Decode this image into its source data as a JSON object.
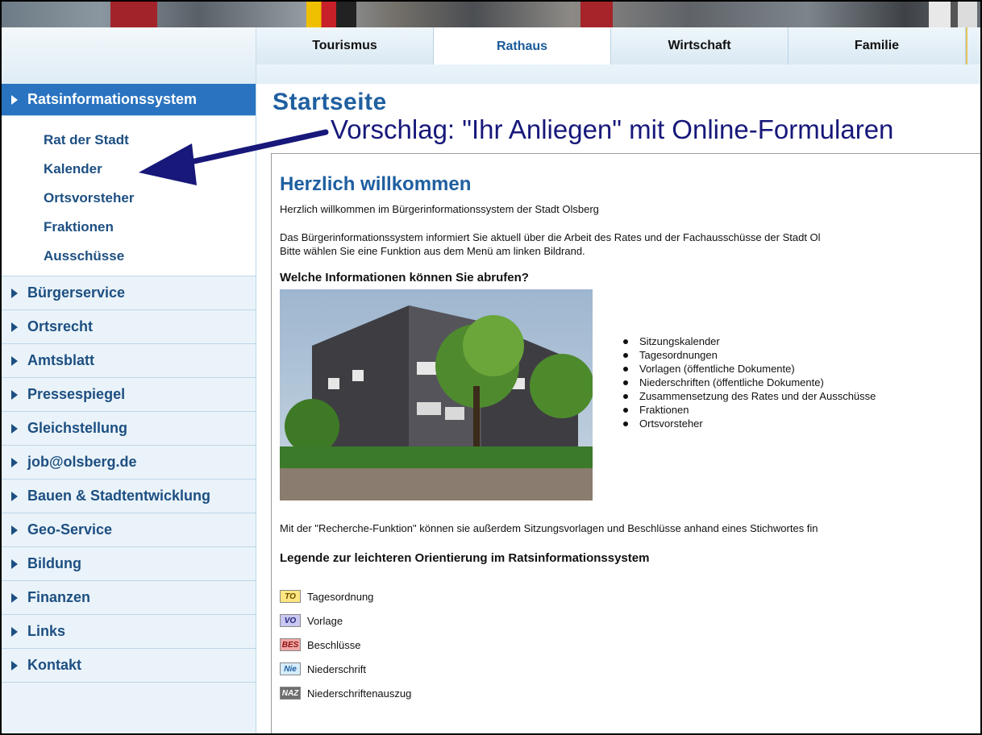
{
  "top_nav": {
    "tabs": [
      {
        "label": "Tourismus",
        "active": false
      },
      {
        "label": "Rathaus",
        "active": true
      },
      {
        "label": "Wirtschaft",
        "active": false
      },
      {
        "label": "Familie",
        "active": false
      }
    ]
  },
  "sidebar": {
    "active_item": "Ratsinformationssystem",
    "sub_items": [
      "Rat der Stadt",
      "Kalender",
      "Ortsvorsteher",
      "Fraktionen",
      "Ausschüsse"
    ],
    "items": [
      "Bürgerservice",
      "Ortsrecht",
      "Amtsblatt",
      "Pressespiegel",
      "Gleichstellung",
      "job@olsberg.de",
      "Bauen & Stadtentwicklung",
      "Geo-Service",
      "Bildung",
      "Finanzen",
      "Links",
      "Kontakt"
    ]
  },
  "main": {
    "page_title": "Startseite",
    "annotation": "Vorschlag: \"Ihr Anliegen\" mit Online-Formularen",
    "welcome_heading": "Herzlich willkommen",
    "welcome_text": "Herzlich willkommen im Bürgerinformationssystem der Stadt Olsberg",
    "intro_line1": "Das Bürgerinformationssystem informiert Sie aktuell über die Arbeit des Rates und der Fachausschüsse der Stadt Ol",
    "intro_line2": "Bitte wählen Sie eine Funktion aus dem Menü am linken Bildrand.",
    "info_heading": "Welche Informationen können Sie abrufen?",
    "info_list": [
      "Sitzungskalender",
      "Tagesordnungen",
      "Vorlagen (öffentliche Dokumente)",
      "Niederschriften (öffentliche Dokumente)",
      "Zusammensetzung des Rates und der Ausschüsse",
      "Fraktionen",
      "Ortsvorsteher"
    ],
    "search_text": "Mit der \"Recherche-Funktion\" können sie außerdem Sitzungsvorlagen und Beschlüsse anhand eines Stichwortes fin",
    "legend_heading": "Legende zur leichteren Orientierung im Ratsinformationssystem",
    "legend": [
      {
        "code": "TO",
        "label": "Tagesordnung"
      },
      {
        "code": "VO",
        "label": "Vorlage"
      },
      {
        "code": "BES",
        "label": "Beschlüsse"
      },
      {
        "code": "Nie",
        "label": "Niederschrift"
      },
      {
        "code": "NAZ",
        "label": "Niederschriftenauszug"
      }
    ]
  },
  "colors": {
    "accent": "#1f5fa0",
    "sidebar_active": "#2a73c0",
    "annotation": "#17187a"
  }
}
